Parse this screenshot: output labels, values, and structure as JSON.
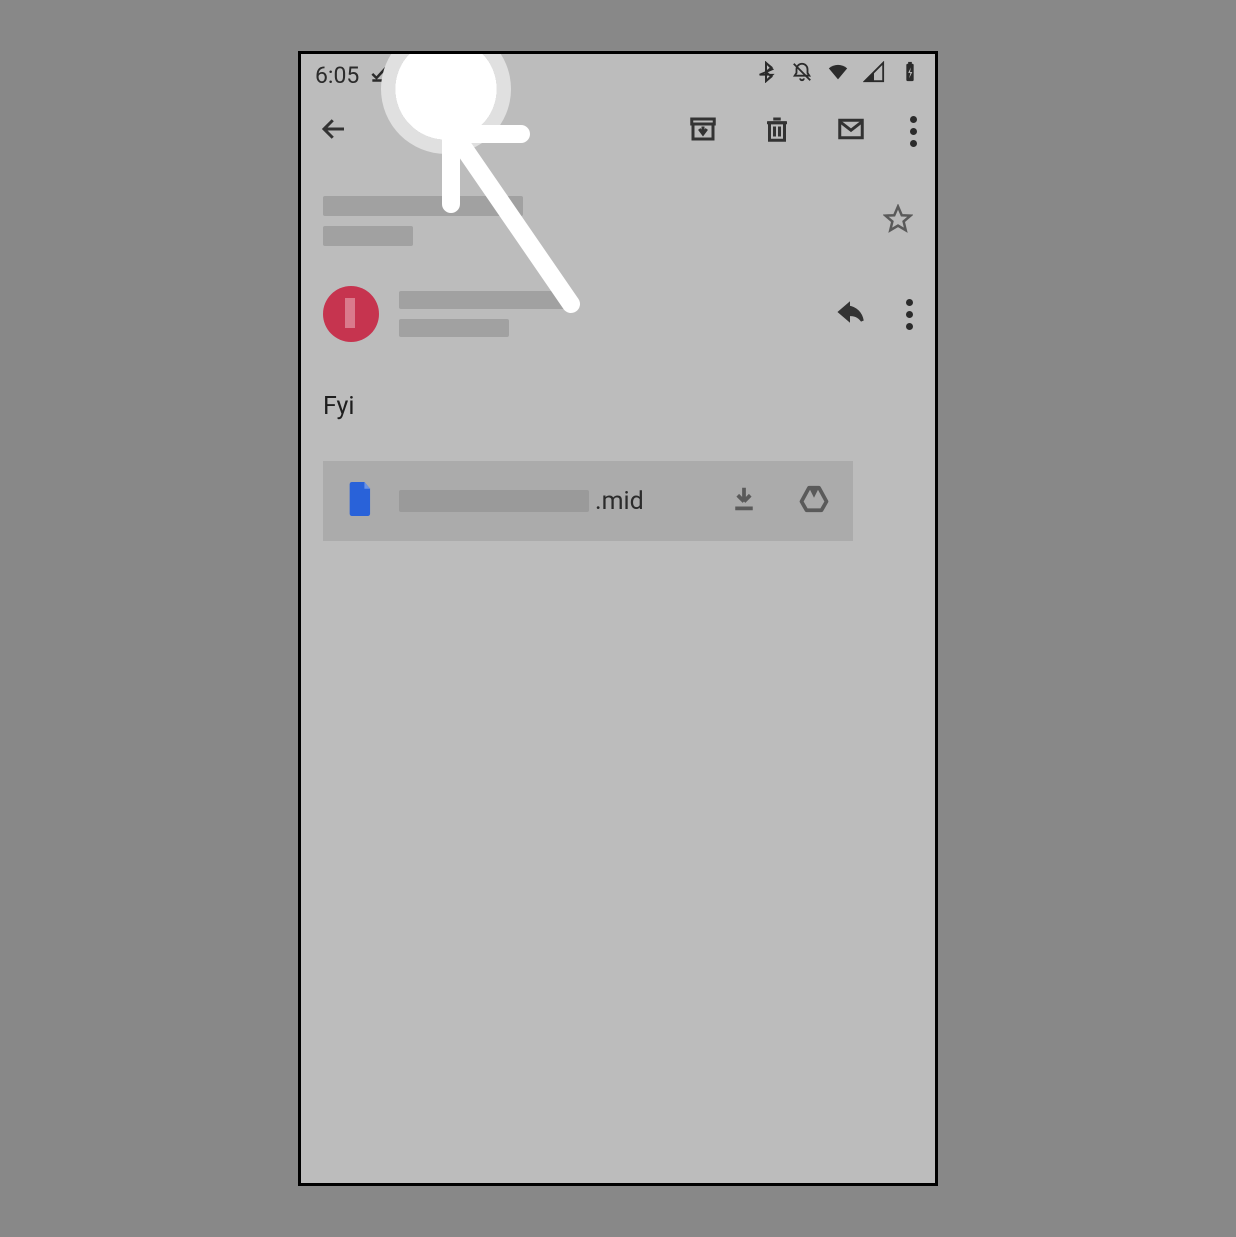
{
  "statusbar": {
    "time": "6:05"
  },
  "email": {
    "body_text": "Fyi",
    "attachment": {
      "ext": ".mid"
    }
  }
}
